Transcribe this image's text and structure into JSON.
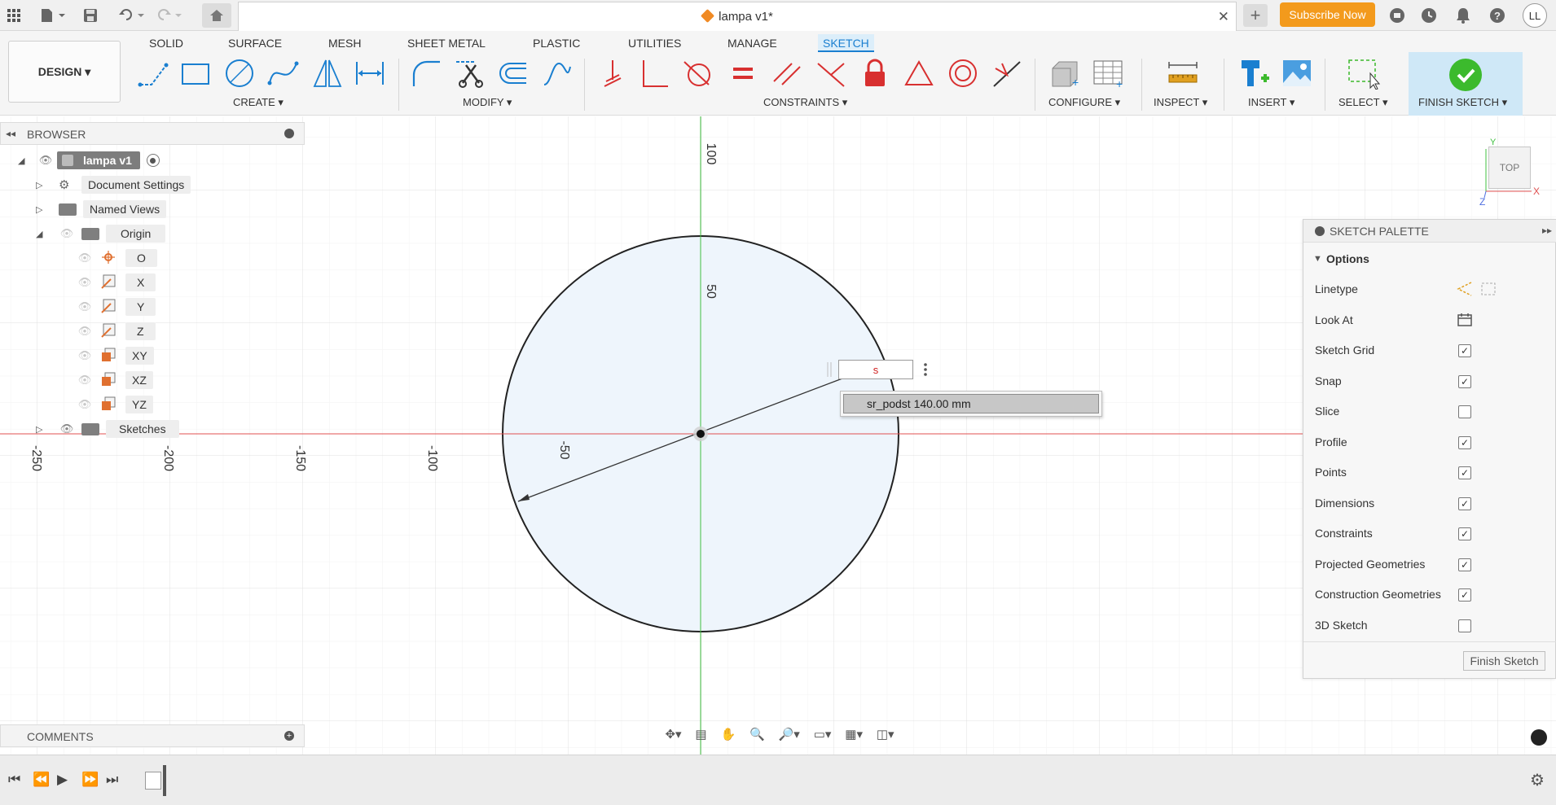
{
  "app": {
    "document_title": "lampa v1*",
    "subscribe_label": "Subscribe Now",
    "user_initials": "LL"
  },
  "toolbar_icons": [
    "grid-menu-icon",
    "file-icon",
    "save-icon",
    "undo-icon",
    "redo-icon",
    "home-icon",
    "close-icon",
    "new-tab-icon",
    "extensions-icon",
    "history-icon",
    "bell-icon",
    "help-icon"
  ],
  "ribbon": {
    "workspace_label": "DESIGN ▾",
    "tabs": [
      "SOLID",
      "SURFACE",
      "MESH",
      "SHEET METAL",
      "PLASTIC",
      "UTILITIES",
      "MANAGE",
      "SKETCH"
    ],
    "active_tab": "SKETCH",
    "groups": {
      "create": "CREATE ▾",
      "modify": "MODIFY ▾",
      "constraints": "CONSTRAINTS ▾",
      "configure": "CONFIGURE ▾",
      "inspect": "INSPECT ▾",
      "insert": "INSERT ▾",
      "select": "SELECT ▾",
      "finish": "FINISH SKETCH ▾"
    }
  },
  "browser": {
    "title": "BROWSER",
    "root": "lampa v1",
    "items": [
      {
        "label": "Document Settings"
      },
      {
        "label": "Named Views"
      },
      {
        "label": "Origin"
      },
      {
        "label": "O"
      },
      {
        "label": "X"
      },
      {
        "label": "Y"
      },
      {
        "label": "Z"
      },
      {
        "label": "XY"
      },
      {
        "label": "XZ"
      },
      {
        "label": "YZ"
      },
      {
        "label": "Sketches"
      }
    ]
  },
  "canvas": {
    "x_axis_ticks": [
      "-250",
      "-200",
      "-150",
      "-100",
      "-50"
    ],
    "y_axis_ticks": [
      "100",
      "50"
    ],
    "axis_colors": {
      "x": "#e05050",
      "y": "#40c040"
    },
    "circle_fill": "#eef5fc",
    "dimension_input_value": "s",
    "autocomplete_item": "sr_podst 140.00 mm"
  },
  "viewcube": {
    "face": "TOP",
    "axis_x": "X",
    "axis_y": "Y",
    "axis_z": "Z"
  },
  "palette": {
    "title": "SKETCH PALETTE",
    "options_title": "Options",
    "rows": [
      {
        "label": "Linetype"
      },
      {
        "label": "Look At"
      },
      {
        "label": "Sketch Grid",
        "checked": true
      },
      {
        "label": "Snap",
        "checked": true
      },
      {
        "label": "Slice",
        "checked": false
      },
      {
        "label": "Profile",
        "checked": true
      },
      {
        "label": "Points",
        "checked": true
      },
      {
        "label": "Dimensions",
        "checked": true
      },
      {
        "label": "Constraints",
        "checked": true
      },
      {
        "label": "Projected Geometries",
        "checked": true
      },
      {
        "label": "Construction Geometries",
        "checked": true
      },
      {
        "label": "3D Sketch",
        "checked": false
      }
    ],
    "finish_button": "Finish Sketch"
  },
  "comments": {
    "title": "COMMENTS"
  },
  "colors": {
    "accent": "#1a7fd0",
    "subscribe": "#f39a1c",
    "finish_green": "#3cba2d"
  }
}
